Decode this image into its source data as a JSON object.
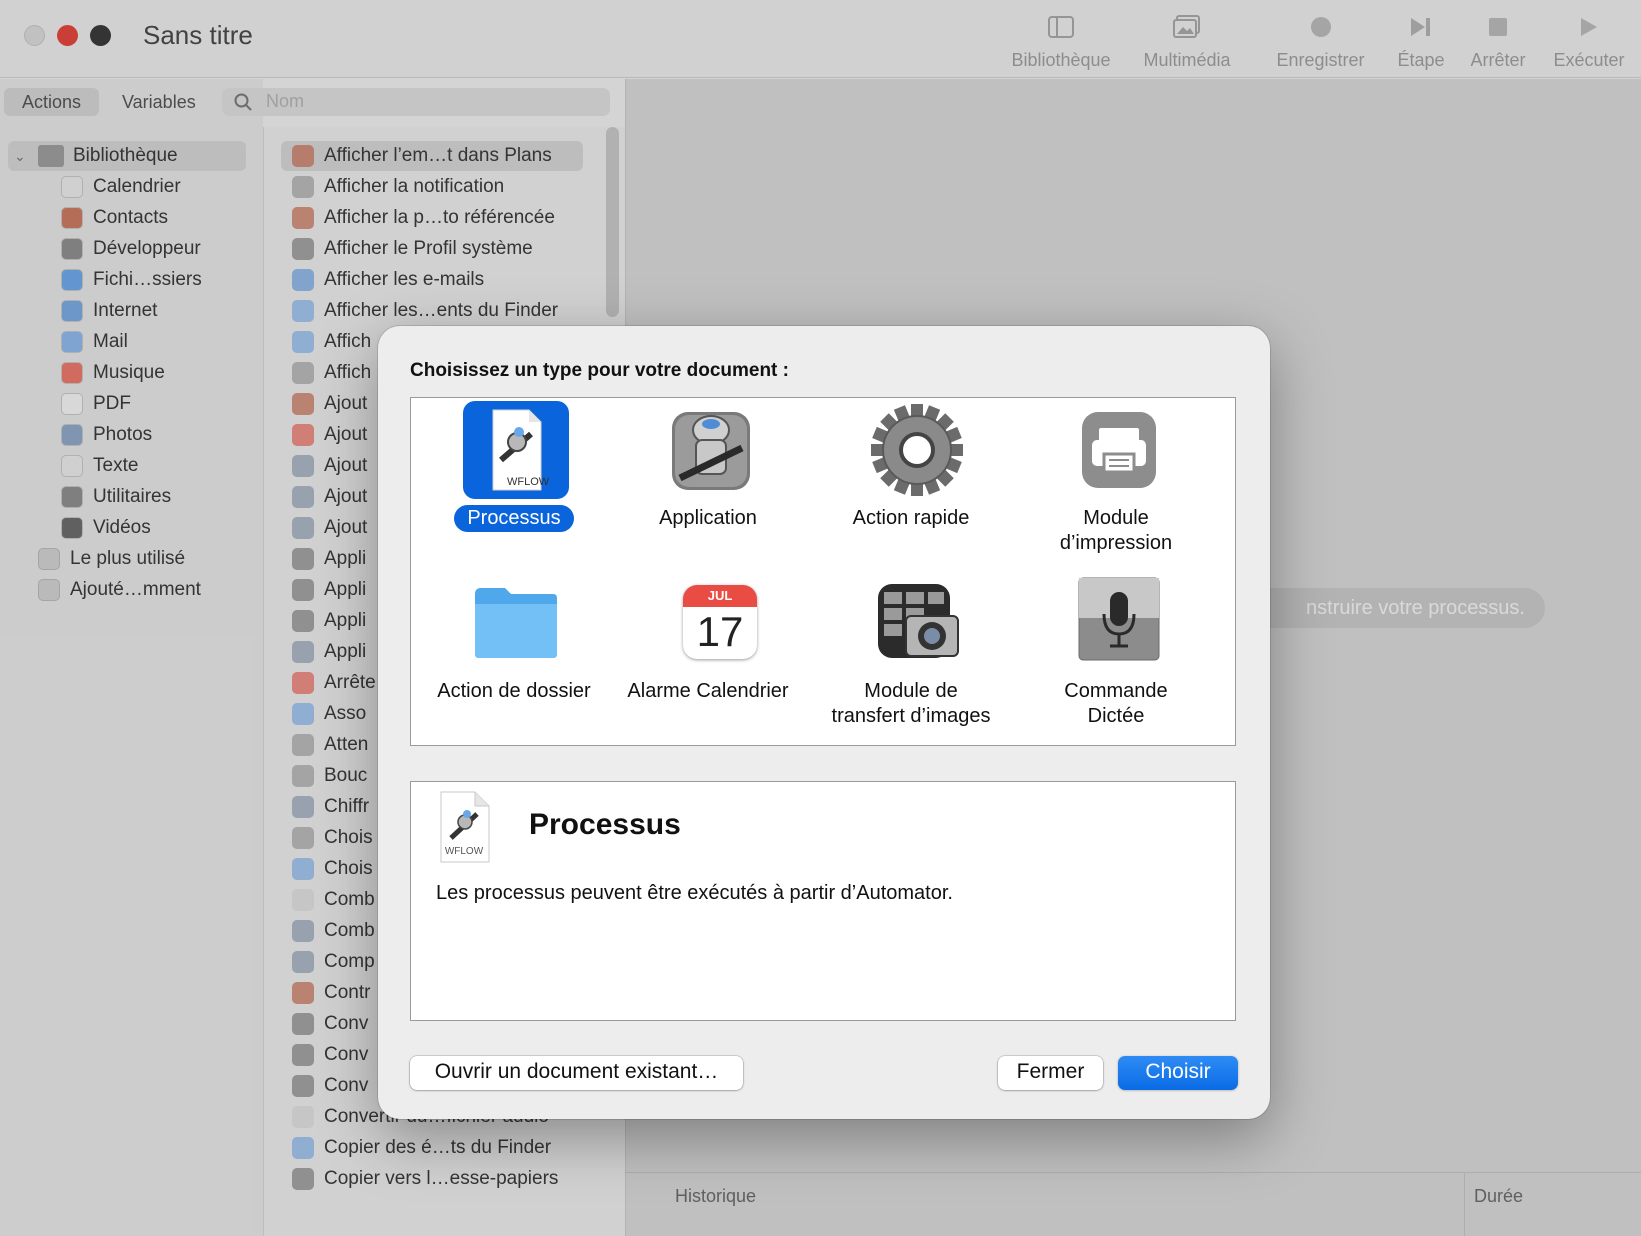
{
  "window": {
    "title": "Sans titre"
  },
  "toolbar": [
    {
      "label": "Bibliothèque",
      "icon": "sidebar-icon"
    },
    {
      "label": "Multimédia",
      "icon": "photos-icon"
    },
    {
      "label": "Enregistrer",
      "icon": "record-icon"
    },
    {
      "label": "Étape",
      "icon": "step-icon"
    },
    {
      "label": "Arrêter",
      "icon": "stop-icon"
    },
    {
      "label": "Exécuter",
      "icon": "play-icon"
    }
  ],
  "library": {
    "tabs": [
      "Actions",
      "Variables"
    ],
    "search_placeholder": "Nom",
    "root": "Bibliothèque",
    "items": [
      "Calendrier",
      "Contacts",
      "Développeur",
      "Fichi…ssiers",
      "Internet",
      "Mail",
      "Musique",
      "PDF",
      "Photos",
      "Texte",
      "Utilitaires",
      "Vidéos"
    ],
    "extra": [
      "Le plus utilisé",
      "Ajouté…mment"
    ]
  },
  "actions": [
    "Afficher l’em…t dans Plans",
    "Afficher la notification",
    "Afficher la p…to référencée",
    "Afficher le Profil système",
    "Afficher les e-mails",
    "Afficher les…ents du Finder",
    "Affich",
    "Affich",
    "Ajout",
    "Ajout",
    "Ajout",
    "Ajout",
    "Ajout",
    "Appli",
    "Appli",
    "Appli",
    "Appli",
    "Arrête",
    "Asso",
    "Atten",
    "Bouc",
    "Chiffr",
    "Chois",
    "Chois",
    "Comb",
    "Comb",
    "Comp",
    "Contr",
    "Conv",
    "Conv",
    "Conv",
    "Convertir du…fichier audio",
    "Copier des é…ts du Finder",
    "Copier vers l…esse-papiers"
  ],
  "workflow": {
    "hint": "nstruire votre processus.",
    "history_label": "Historique",
    "duration_label": "Durée"
  },
  "dialog": {
    "title": "Choisissez un type pour votre document :",
    "types": [
      {
        "label": "Processus",
        "icon": "workflow-file-icon"
      },
      {
        "label": "Application",
        "icon": "automator-robot-icon"
      },
      {
        "label": "Action rapide",
        "icon": "gear-icon"
      },
      {
        "label": "Module\nd’impression",
        "icon": "printer-icon"
      },
      {
        "label": "Action de dossier",
        "icon": "folder-icon"
      },
      {
        "label": "Alarme Calendrier",
        "icon": "calendar-icon"
      },
      {
        "label": "Module de\ntransfert d’images",
        "icon": "image-capture-icon"
      },
      {
        "label": "Commande\nDictée",
        "icon": "microphone-icon"
      }
    ],
    "calendar_month": "JUL",
    "calendar_day": "17",
    "wflow_tag": "WFLOW",
    "selected_type": "Processus",
    "description_title": "Processus",
    "description_text": "Les processus peuvent être exécutés à partir d’Automator.",
    "buttons": {
      "open_existing": "Ouvrir un document existant…",
      "close": "Fermer",
      "choose": "Choisir"
    },
    "accent_color": "#0a64dc"
  }
}
